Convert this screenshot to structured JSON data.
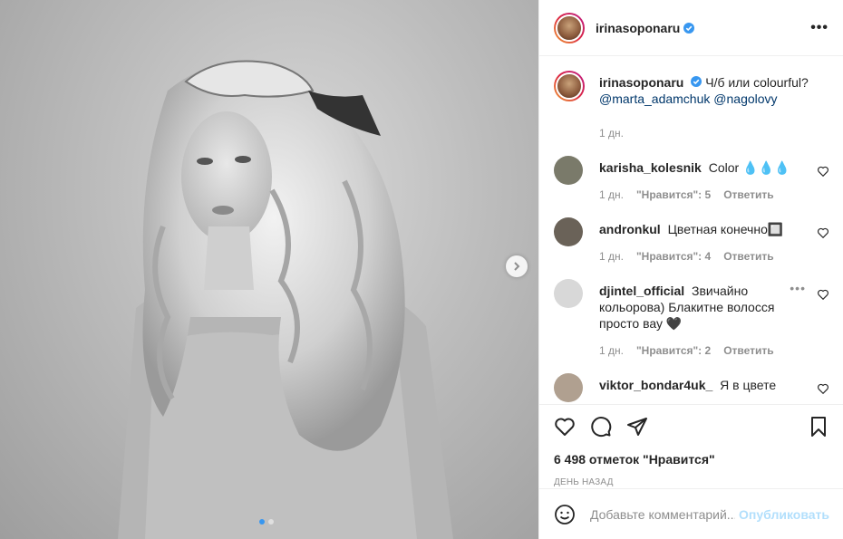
{
  "post": {
    "author": "irinasoponaru",
    "more_icon": "more-horizontal-icon",
    "caption": {
      "author": "irinasoponaru",
      "text": "Ч/б или colourful?",
      "mentions": [
        "@marta_adamchuk",
        "@nagolovy"
      ],
      "time": "1 дн."
    },
    "carousel": {
      "slide_count": 2,
      "active_slide": 1
    }
  },
  "comments": [
    {
      "user": "karisha_kolesnik",
      "text": "Color 💧💧💧",
      "time": "1 дн.",
      "likes": "\"Нравится\": 5",
      "reply": "Ответить",
      "avatar_color": "#7a7a6a"
    },
    {
      "user": "andronkul",
      "text": "Цветная конечно🔲",
      "time": "1 дн.",
      "likes": "\"Нравится\": 4",
      "reply": "Ответить",
      "avatar_color": "#6a6258"
    },
    {
      "user": "djintel_official",
      "text": "Звичайно кольорова) Блакитне волосся просто вау 🖤",
      "time": "1 дн.",
      "likes": "\"Нравится\": 2",
      "reply": "Ответить",
      "avatar_color": "#d8d8d8"
    },
    {
      "user": "viktor_bondar4uk_",
      "text": "Я в цвете",
      "avatar_color": "#b0a090"
    }
  ],
  "actions": {
    "likes_text": "6 498 отметок \"Нравится\"",
    "date_text": "День назад"
  },
  "add_comment": {
    "placeholder": "Добавьте комментарий...",
    "post_label": "Опубликовать"
  },
  "colors": {
    "accent": "#3897f0",
    "verified": "#3897f0",
    "mention": "#00376b",
    "post_disabled": "#b2dffc"
  }
}
